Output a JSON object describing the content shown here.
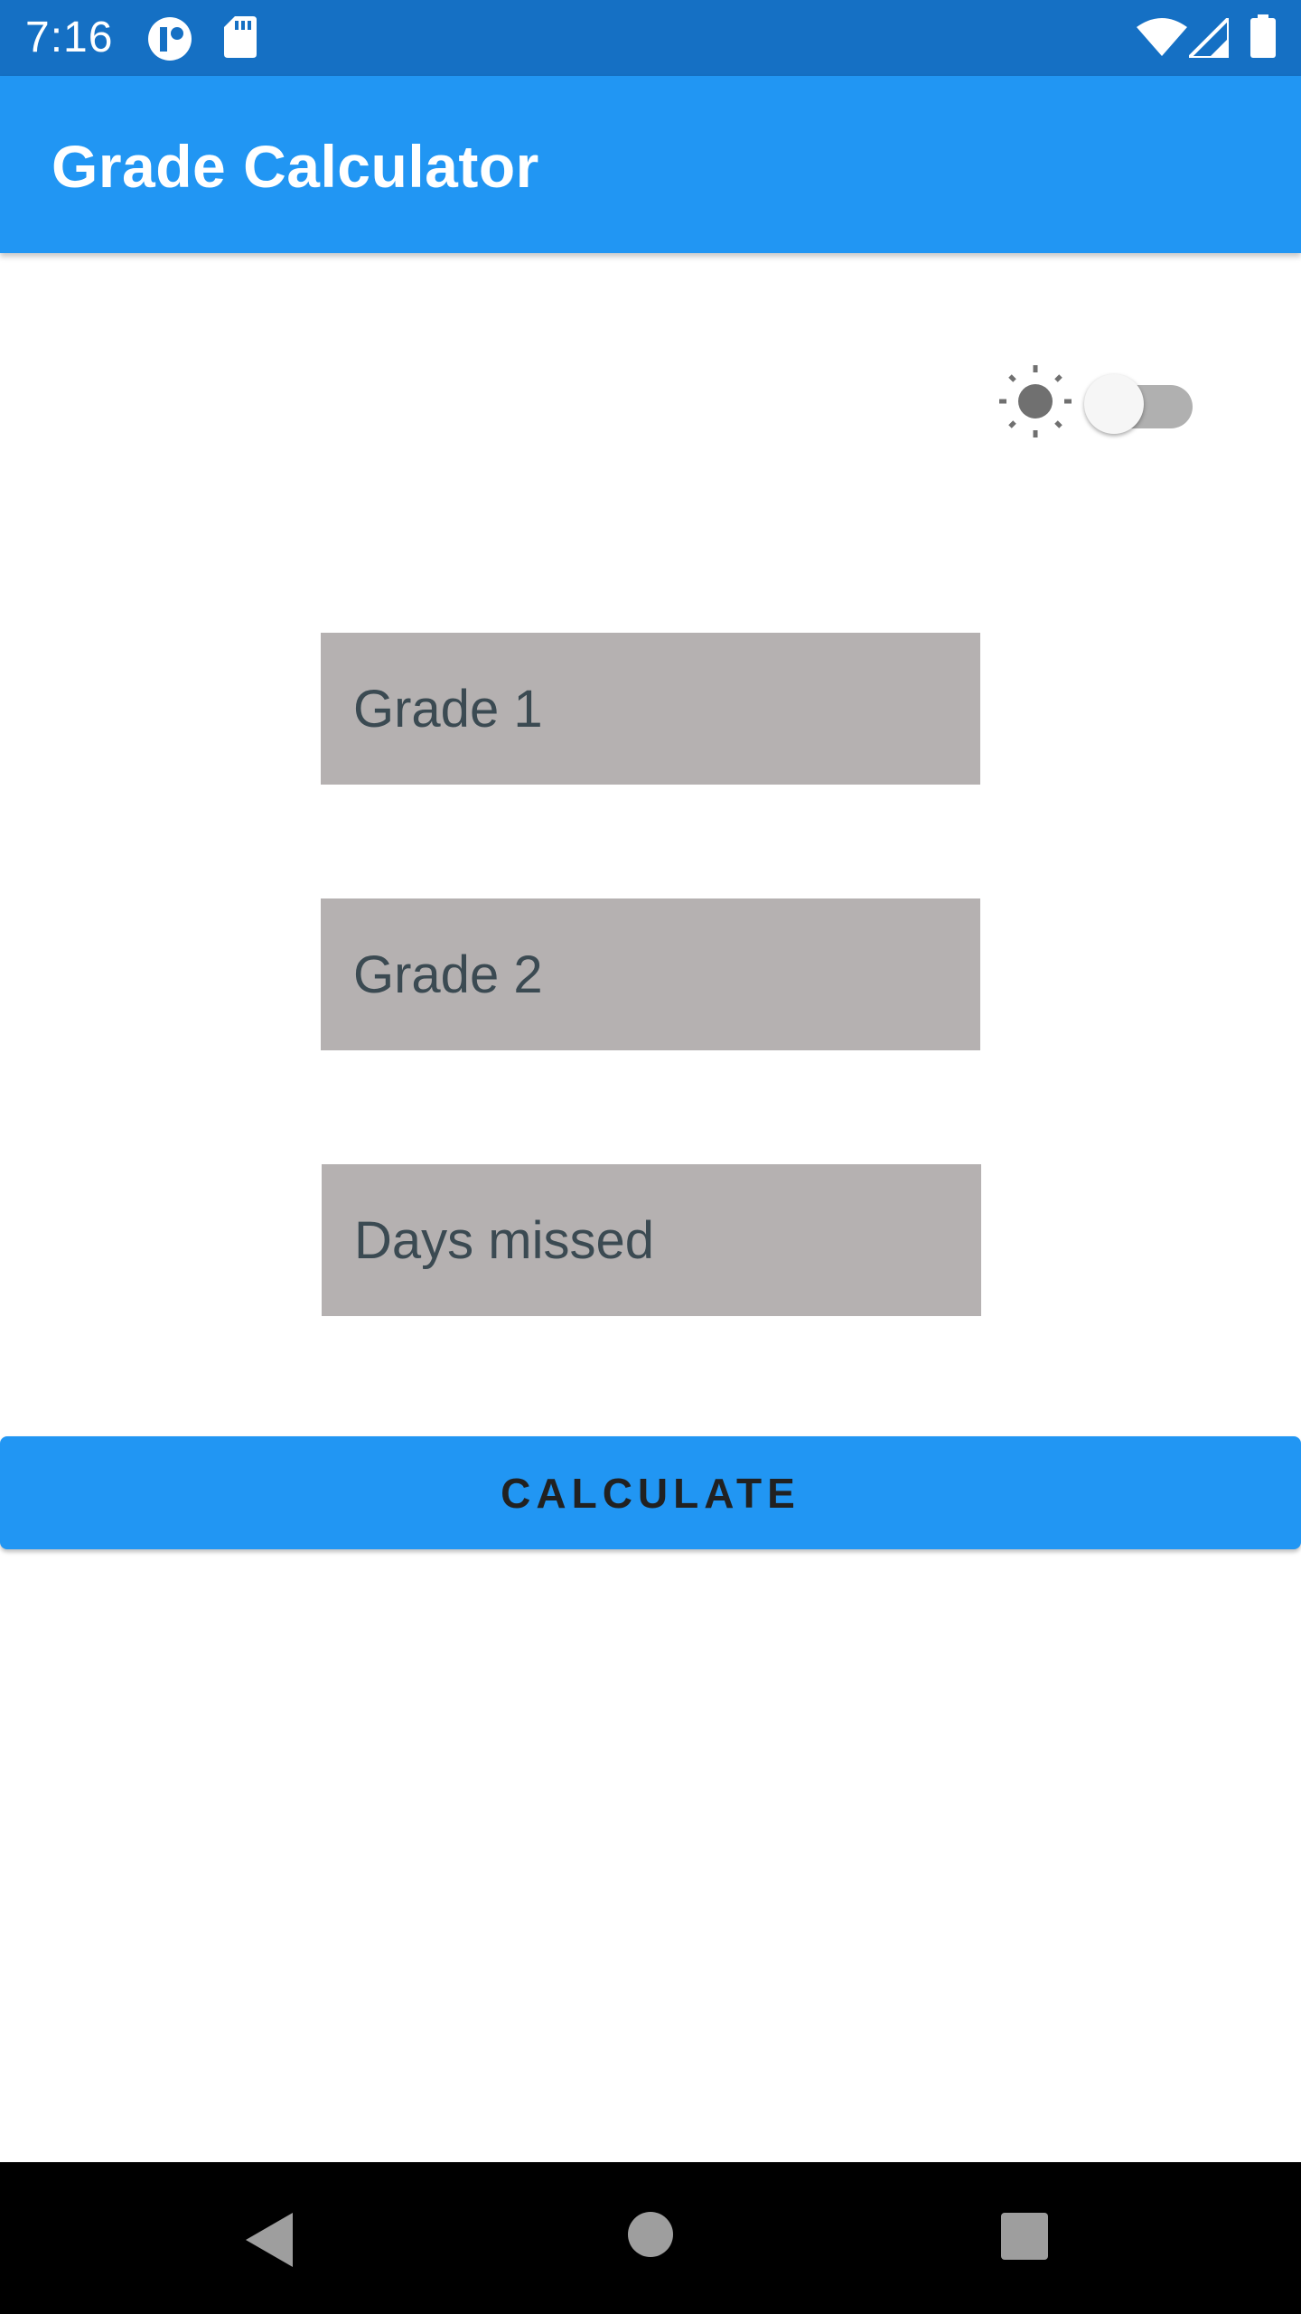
{
  "status_bar": {
    "time": "7:16",
    "icons": [
      "app-notification-icon",
      "sd-card-icon",
      "wifi-icon",
      "cell-signal-icon",
      "battery-icon"
    ]
  },
  "app_bar": {
    "title": "Grade Calculator"
  },
  "theme_toggle": {
    "icon": "sun-icon",
    "checked": false
  },
  "form": {
    "grade1_placeholder": "Grade 1",
    "grade2_placeholder": "Grade 2",
    "days_missed_placeholder": "Days missed"
  },
  "calculate_button": {
    "label": "CALCULATE"
  },
  "nav_bar": {
    "icons": [
      "back-icon",
      "home-icon",
      "recents-icon"
    ]
  },
  "colors": {
    "status_bar": "#1570c4",
    "app_bar": "#2196f3",
    "field_background": "#b5b1b1",
    "button": "#2196f3"
  }
}
